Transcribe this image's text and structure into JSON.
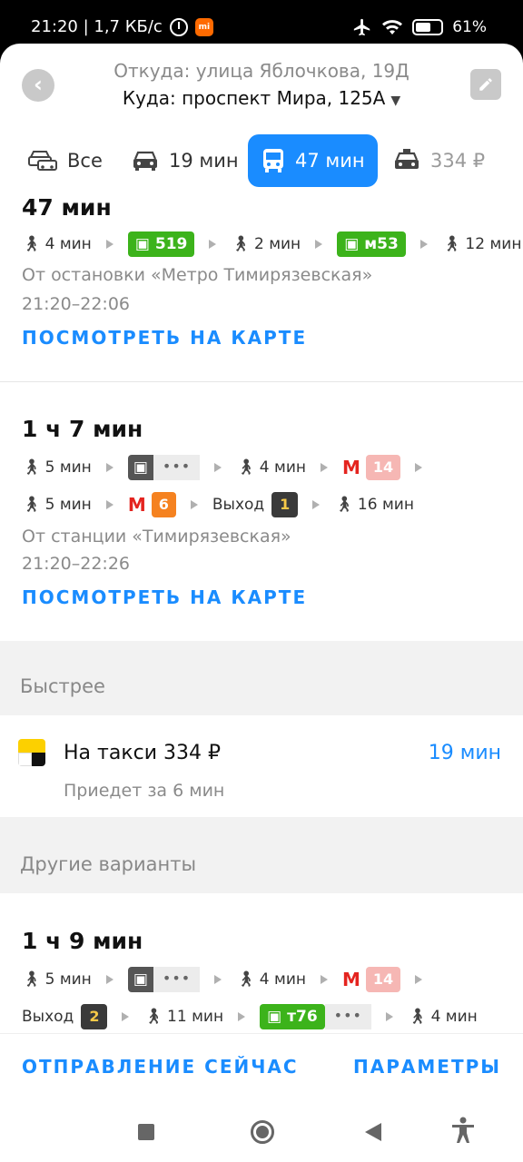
{
  "status_bar": {
    "time_speed": "21:20 | 1,7 КБ/с",
    "mi_label": "mi",
    "battery": "61%",
    "battery_level": 0.61
  },
  "header": {
    "from": "Откуда: улица Яблочкова, 19Д",
    "to": "Куда: проспект Мира, 125А"
  },
  "modes": [
    {
      "label": "Все",
      "icon": "car-multi-icon"
    },
    {
      "label": "19 мин",
      "icon": "car-icon"
    },
    {
      "label": "47 мин",
      "icon": "bus-icon",
      "active": true
    },
    {
      "label": "334 ₽",
      "icon": "taxi-icon"
    }
  ],
  "routes": [
    {
      "title": "47 мин",
      "rows": [
        [
          {
            "type": "walk",
            "text": "4 мин"
          },
          {
            "type": "bus",
            "text": "519"
          },
          {
            "type": "walk",
            "text": "2 мин"
          },
          {
            "type": "bus",
            "text": "м53"
          },
          {
            "type": "walk",
            "text": "12 мин"
          }
        ]
      ],
      "from_text": "От остановки «Метро Тимирязевская»",
      "time_range": "21:20–22:06",
      "link": "ПОСМОТРЕТЬ НА КАРТЕ"
    },
    {
      "title": "1 ч 7 мин",
      "rows": [
        [
          {
            "type": "walk",
            "text": "5 мин"
          },
          {
            "type": "tram",
            "text": "•••"
          },
          {
            "type": "walk",
            "text": "4 мин"
          },
          {
            "type": "metro",
            "text": "14"
          }
        ],
        [
          {
            "type": "walk",
            "text": "5 мин"
          },
          {
            "type": "metro",
            "text": "6"
          },
          {
            "type": "exit",
            "label": "Выход",
            "text": "1"
          },
          {
            "type": "walk",
            "text": "16 мин"
          }
        ]
      ],
      "from_text": "От станции «Тимирязевская»",
      "time_range": "21:20–22:26",
      "link": "ПОСМОТРЕТЬ НА КАРТЕ"
    },
    {
      "title": "1 ч 9 мин",
      "rows": [
        [
          {
            "type": "walk",
            "text": "5 мин"
          },
          {
            "type": "tram",
            "text": "•••"
          },
          {
            "type": "walk",
            "text": "4 мин"
          },
          {
            "type": "metro",
            "text": "14"
          }
        ],
        [
          {
            "type": "exit",
            "label": "Выход",
            "text": "2"
          },
          {
            "type": "walk",
            "text": "11 мин"
          },
          {
            "type": "bus",
            "text": "т76",
            "dots": "•••"
          },
          {
            "type": "walk",
            "text": "4 мин"
          }
        ]
      ]
    }
  ],
  "faster": {
    "section_label": "Быстрее",
    "taxi_title": "На такси 334 ₽",
    "taxi_time": "19 мин",
    "taxi_sub": "Приедет за 6 мин"
  },
  "other": {
    "section_label": "Другие варианты"
  },
  "bottom": {
    "departure": "ОТПРАВЛЕНИЕ СЕЙЧАС",
    "params": "ПАРАМЕТРЫ"
  },
  "colors": {
    "accent": "#1a8cff",
    "bus_green": "#3cb31b",
    "metro_red": "#e4241f",
    "line14": "#f6b7b4",
    "line6": "#f58220"
  }
}
